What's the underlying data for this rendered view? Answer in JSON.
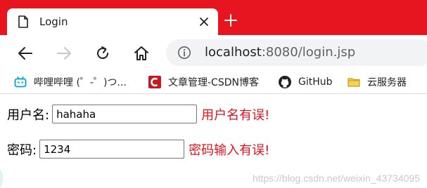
{
  "tab": {
    "title": "Login",
    "favicon": "page-icon",
    "close": "close-icon",
    "new_tab": "plus-icon"
  },
  "toolbar": {
    "back": "back-arrow-icon",
    "forward": "forward-arrow-icon",
    "reload": "reload-icon",
    "home": "home-icon",
    "address": {
      "host": "localhost",
      "rest": ":8080/login.jsp"
    }
  },
  "bookmarks": [
    {
      "label": "哔哩哔哩 (゜-゜)つ...",
      "icon": "bilibili-icon"
    },
    {
      "label": "文章管理-CSDN博客",
      "icon": "csdn-icon"
    },
    {
      "label": "GitHub",
      "icon": "github-icon"
    },
    {
      "label": "云服务器",
      "icon": "folder-icon"
    }
  ],
  "form": {
    "username_label": "用户名:",
    "username_value": "hahaha",
    "username_error": "用户名有误!",
    "password_label": "密码:",
    "password_value": "1234",
    "password_error": "密码输入有误!"
  },
  "watermark": "https://blog.csdn.net/weixin_43734095",
  "colors": {
    "tabstrip": "#e6151f",
    "error": "#e0141e"
  }
}
